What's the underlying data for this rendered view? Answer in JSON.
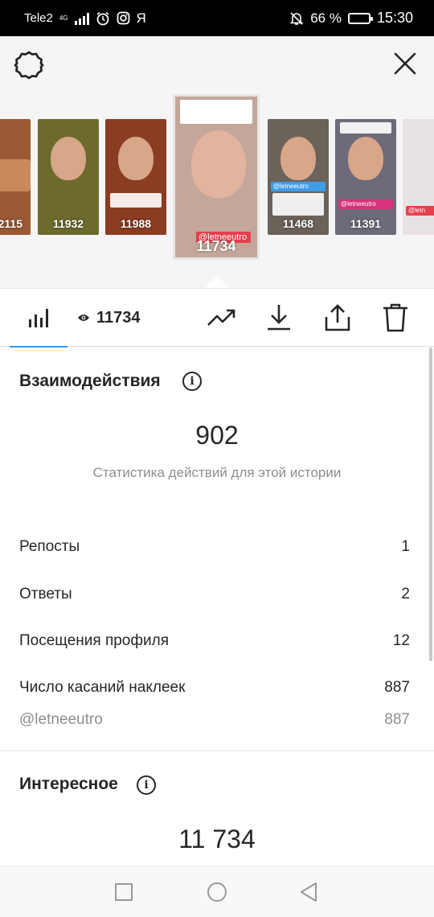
{
  "status_bar": {
    "carrier": "Tele2",
    "network": "4G",
    "extra_icons": [
      "alarm-icon",
      "instagram-icon",
      "yandex-icon"
    ],
    "yandex_glyph": "Я",
    "battery": "66 %",
    "battery_level": 0.66,
    "time": "15:30"
  },
  "stories": {
    "thumbnails": [
      {
        "views": "2115",
        "color": "#9b5a36"
      },
      {
        "views": "11932",
        "color": "#6d6a2e"
      },
      {
        "views": "11988",
        "color": "#8a3d22"
      },
      {
        "views": "11468",
        "color": "#6b625a"
      },
      {
        "views": "11391",
        "color": "#6f6a7a"
      },
      {
        "views": "",
        "color": "#e9e2e4"
      }
    ],
    "selected": {
      "views": "11734",
      "mention": "@letneeutro"
    },
    "tag_labels": [
      "@letneeutro",
      "@letneeutro",
      "@letn"
    ]
  },
  "toolbar": {
    "views_count": "11734",
    "icons": [
      "bar-chart-icon",
      "eye-icon",
      "trending-icon",
      "download-icon",
      "share-icon",
      "trash-icon"
    ]
  },
  "interactions": {
    "title": "Взаимодействия",
    "total": "902",
    "subtitle": "Статистика действий для этой истории",
    "rows": [
      {
        "label": "Репосты",
        "value": "1"
      },
      {
        "label": "Ответы",
        "value": "2"
      },
      {
        "label": "Посещения профиля",
        "value": "12"
      },
      {
        "label": "Число касаний наклеек",
        "value": "887"
      }
    ],
    "sub_row": {
      "label": "@letneeutro",
      "value": "887"
    }
  },
  "discovery": {
    "title": "Интересное",
    "total": "11 734"
  },
  "colors": {
    "accent": "#3897f0",
    "text": "#262626",
    "muted": "#8e8e8e",
    "mention_red": "#e6404f",
    "tag_blue": "#3f9ce8",
    "tag_pink": "#d6337a"
  }
}
